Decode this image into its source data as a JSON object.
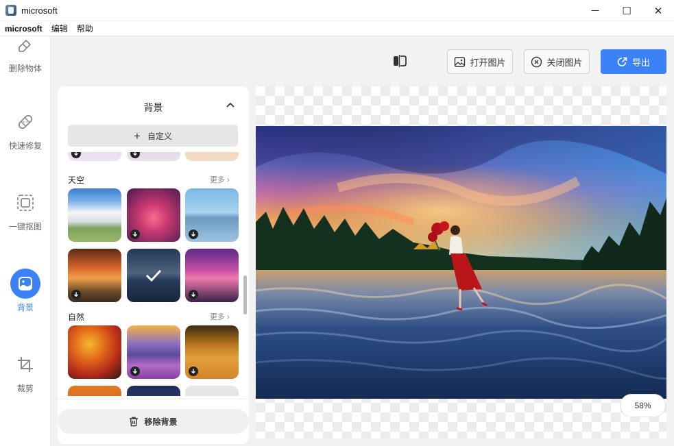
{
  "window": {
    "title": "microsoft",
    "minimize_label": "─",
    "maximize_label": "☐",
    "close_label": "✕"
  },
  "menu": {
    "items": [
      "microsoft",
      "编辑",
      "帮助"
    ]
  },
  "tools": [
    {
      "label": "删除物体",
      "icon": "eraser-icon"
    },
    {
      "label": "快速修复",
      "icon": "bandage-icon"
    },
    {
      "label": "一键抠图",
      "icon": "cutout-icon"
    },
    {
      "label": "背景",
      "icon": "image-icon",
      "active": true
    },
    {
      "label": "裁剪",
      "icon": "crop-icon"
    }
  ],
  "toolbar": {
    "compare_icon": "compare-icon",
    "open_label": "打开图片",
    "close_label": "关闭图片",
    "export_label": "导出"
  },
  "panel": {
    "title": "背景",
    "custom_label": "自定义",
    "sections": [
      {
        "title": "天空",
        "more_label": "更多"
      },
      {
        "title": "自然",
        "more_label": "更多"
      }
    ],
    "remove_label": "移除背景"
  },
  "canvas": {
    "zoom_label": "58%"
  },
  "colors": {
    "accent": "#3b82f6",
    "canvas_bg": "#f2f2f2"
  }
}
